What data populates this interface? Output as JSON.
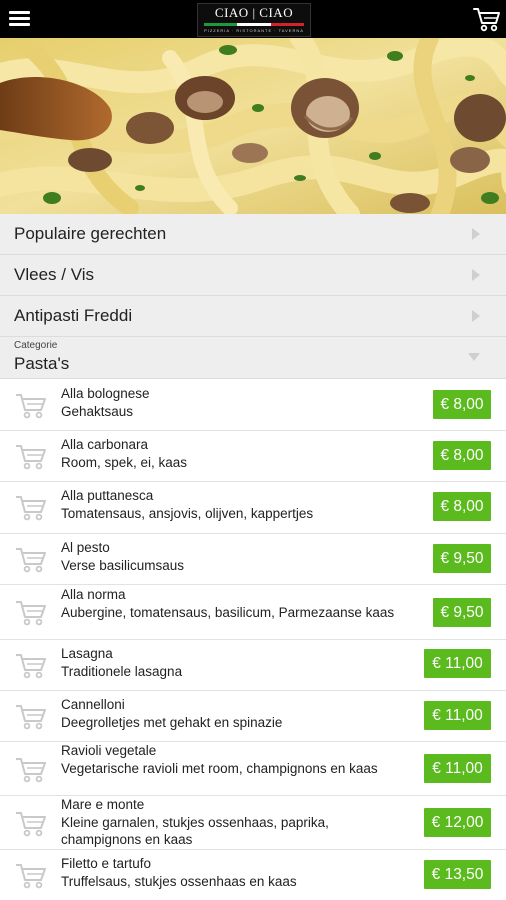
{
  "header": {
    "menu_icon": "hamburger-icon",
    "logo": {
      "text": "CIAO | CIAO",
      "subtitle": "PIZZERIA · RISTORANTE · TAVERNA"
    },
    "cart_icon": "shopping-cart-icon"
  },
  "hero": {
    "image": "pasta-with-mushrooms-photo"
  },
  "categories": [
    {
      "label": "Populaire gerechten"
    },
    {
      "label": "Vlees / Vis"
    },
    {
      "label": "Antipasti Freddi"
    }
  ],
  "category_select": {
    "label": "Categorie",
    "value": "Pasta's"
  },
  "products": [
    {
      "name": "Alla bolognese",
      "description": "Gehaktsaus",
      "price": "€ 8,00"
    },
    {
      "name": "Alla carbonara",
      "description": "Room, spek, ei, kaas",
      "price": "€ 8,00"
    },
    {
      "name": "Alla puttanesca",
      "description": "Tomatensaus, ansjovis, olijven, kappertjes",
      "price": "€ 8,00"
    },
    {
      "name": "Al pesto",
      "description": "Verse basilicumsaus",
      "price": "€ 9,50"
    },
    {
      "name": "Alla norma",
      "description": "Aubergine, tomatensaus, basilicum, Parmezaanse kaas",
      "price": "€ 9,50"
    },
    {
      "name": "Lasagna",
      "description": "Traditionele lasagna",
      "price": "€ 11,00"
    },
    {
      "name": "Cannelloni",
      "description": "Deegrolletjes met gehakt en spinazie",
      "price": "€ 11,00"
    },
    {
      "name": "Ravioli vegetale",
      "description": "Vegetarische ravioli met room, champignons en kaas",
      "price": "€ 11,00"
    },
    {
      "name": "Mare e monte",
      "description": "Kleine garnalen, stukjes ossenhaas, paprika, champignons en kaas",
      "price": "€ 12,00"
    },
    {
      "name": "Filetto e tartufo",
      "description": "Truffelsaus, stukjes ossenhaas en kaas",
      "price": "€ 13,50"
    }
  ],
  "colors": {
    "price_button": "#5bbb1e",
    "topbar": "#000000",
    "category_bg": "#eeeeee",
    "flag_green": "#1e9a3a",
    "flag_white": "#ffffff",
    "flag_red": "#d2232a"
  }
}
